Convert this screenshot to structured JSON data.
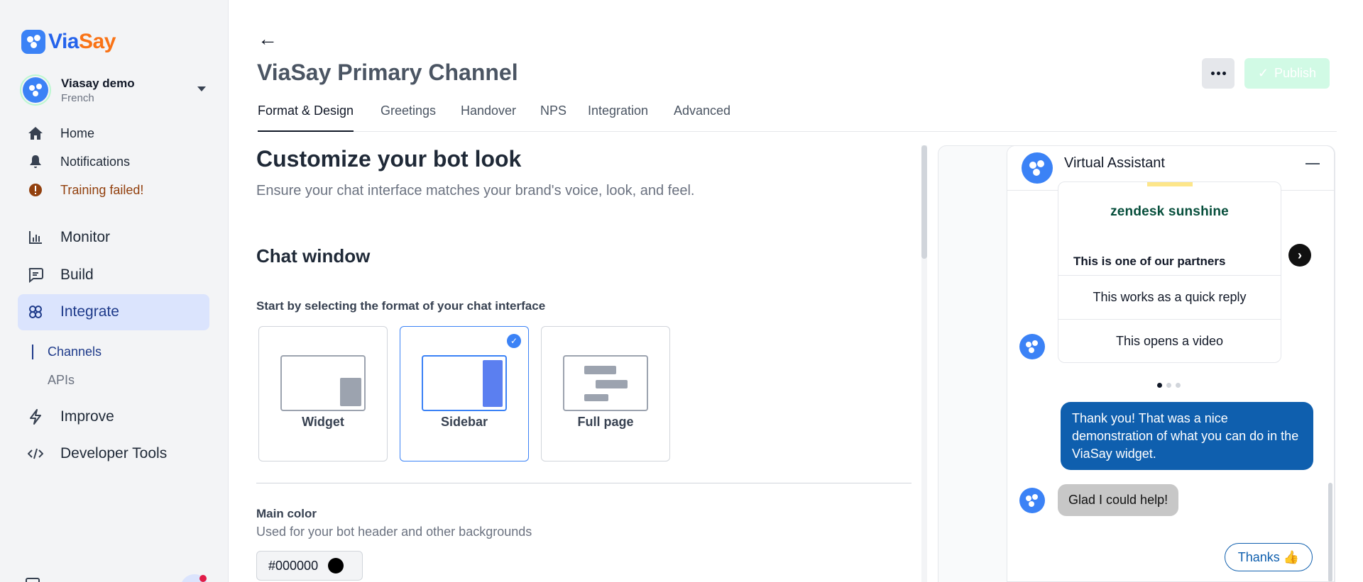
{
  "brand": {
    "logo_via": "Via",
    "logo_say": "Say"
  },
  "account": {
    "name": "Viasay demo",
    "language": "French"
  },
  "sidebar": {
    "items": [
      {
        "label": "Home",
        "icon": "home-icon"
      },
      {
        "label": "Notifications",
        "icon": "bell-icon"
      },
      {
        "label": "Training failed!",
        "icon": "alert-icon"
      },
      {
        "label": "Monitor",
        "icon": "chart-icon"
      },
      {
        "label": "Build",
        "icon": "chat-bubble-icon"
      },
      {
        "label": "Integrate",
        "icon": "integrate-icon"
      },
      {
        "label": "Improve",
        "icon": "bolt-icon"
      },
      {
        "label": "Developer Tools",
        "icon": "code-icon"
      }
    ],
    "sub_items": [
      {
        "label": "Channels"
      },
      {
        "label": "APIs"
      }
    ],
    "active": "Integrate"
  },
  "header": {
    "title": "ViaSay Primary Channel",
    "publish_label": "Publish"
  },
  "tabs": [
    {
      "label": "Format & Design"
    },
    {
      "label": "Greetings"
    },
    {
      "label": "Handover"
    },
    {
      "label": "NPS"
    },
    {
      "label": "Integration"
    },
    {
      "label": "Advanced"
    }
  ],
  "main": {
    "title": "Customize your bot look",
    "description": "Ensure your chat interface matches your brand's voice, look, and feel.",
    "chat_window_title": "Chat window",
    "format_label": "Start by selecting the format of your chat interface",
    "formats": [
      {
        "label": "Widget",
        "selected": false
      },
      {
        "label": "Sidebar",
        "selected": true
      },
      {
        "label": "Full page",
        "selected": false
      }
    ],
    "main_color": {
      "label": "Main color",
      "description": "Used for your bot header and other backgrounds",
      "value": "#000000",
      "swatch": "#000000"
    }
  },
  "preview": {
    "title": "Virtual Assistant",
    "card": {
      "brand_text": "zendesk sunshine",
      "title": "This is one of our partners",
      "buttons": [
        "This works as a quick reply",
        "This opens a video"
      ]
    },
    "user_message": "Thank you! That was a nice demonstration of what you can do in the ViaSay widget.",
    "bot_message": "Glad I could help!",
    "quick_reply": "Thanks 👍"
  },
  "colors": {
    "accent": "#3b82f6",
    "user_bubble": "#0f5fae",
    "warn": "#92400e"
  }
}
